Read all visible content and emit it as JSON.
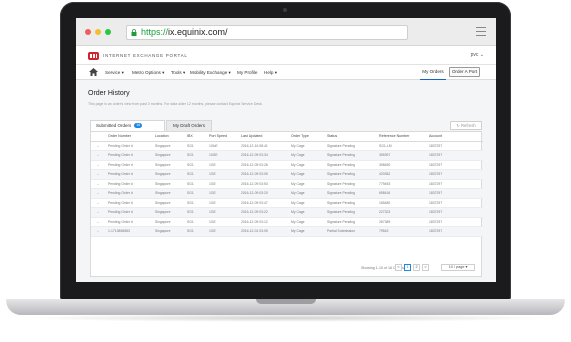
{
  "browser": {
    "url_scheme": "https://",
    "url_host": "ix.equinix.com/",
    "dots": [
      "#ee5f57",
      "#f5be2e",
      "#28c83f"
    ]
  },
  "portal": {
    "title": "INTERNET EXCHANGE PORTAL",
    "user": "pvc",
    "brand_color": "#d2222d"
  },
  "nav": {
    "items": [
      "Service",
      "Metro Options",
      "Tools",
      "Mobility Exchange",
      "My Profile",
      "Help"
    ],
    "my_orders": "My Orders",
    "order_port": "Order A Port"
  },
  "page": {
    "title": "Order History",
    "subtitle": "This page is an order's view from past 3 months. For data older 12 months, please contact Equinix Service Desk."
  },
  "tabs": {
    "submitted": "Submitted Orders",
    "submitted_count": "16",
    "drafts": "My Draft Orders",
    "refresh": "Refresh"
  },
  "table": {
    "headers": [
      "",
      "Order Number",
      "Location",
      "IBX",
      "Port Speed",
      "Last Updated",
      "Order Type",
      "Status",
      "Reference Number",
      "Account"
    ],
    "rows": [
      [
        "+",
        "Pending Order #",
        "Singapore",
        "SG1",
        "1GbE",
        "2016-12-16 08:41",
        "My Cage",
        "Signature Pending",
        "SG1-LM",
        "1837297"
      ],
      [
        "+",
        "Pending Order #",
        "Singapore",
        "SG1",
        "10GE",
        "2016-12-09 03:34",
        "My Cage",
        "Signature Pending",
        "355397",
        "1837297"
      ],
      [
        "+",
        "Pending Order #",
        "Singapore",
        "SG1",
        "1GE",
        "2016-12-09 03:26",
        "My Cage",
        "Signature Pending",
        "398450",
        "1837297"
      ],
      [
        "+",
        "Pending Order #",
        "Singapore",
        "SG1",
        "1GE",
        "2016-12-09 03:05",
        "My Cage",
        "Signature Pending",
        "420352",
        "1837297"
      ],
      [
        "+",
        "Pending Order #",
        "Singapore",
        "SG1",
        "1GE",
        "2016-12-09 03:53",
        "My Cage",
        "Signature Pending",
        "779453",
        "1837297"
      ],
      [
        "+",
        "Pending Order #",
        "Singapore",
        "SG1",
        "1GE",
        "2016-12-09 03:20",
        "My Cage",
        "Signature Pending",
        "698416",
        "1837297"
      ],
      [
        "+",
        "Pending Order #",
        "Singapore",
        "SG1",
        "1GE",
        "2016-12-09 03:47",
        "My Cage",
        "Signature Pending",
        "165480",
        "1837297"
      ],
      [
        "+",
        "Pending Order #",
        "Singapore",
        "SG1",
        "1GE",
        "2016-12-09 03:22",
        "My Cage",
        "Signature Pending",
        "227323",
        "1837297"
      ],
      [
        "+",
        "Pending Order #",
        "Singapore",
        "SG1",
        "1GE",
        "2016-12-09 03:12",
        "My Cage",
        "Signature Pending",
        "267389",
        "1837297"
      ],
      [
        "+",
        "1-1713856583",
        "Singapore",
        "SG1",
        "1GE",
        "2016-12-01 03:05",
        "My Cage",
        "Partial Submission",
        "79543",
        "1837297"
      ]
    ]
  },
  "pagination": {
    "info": "Showing 1-10 of 16 Orders",
    "prev": "<",
    "page1": "1",
    "page2": "2",
    "next": ">",
    "page_size": "10 / page"
  }
}
